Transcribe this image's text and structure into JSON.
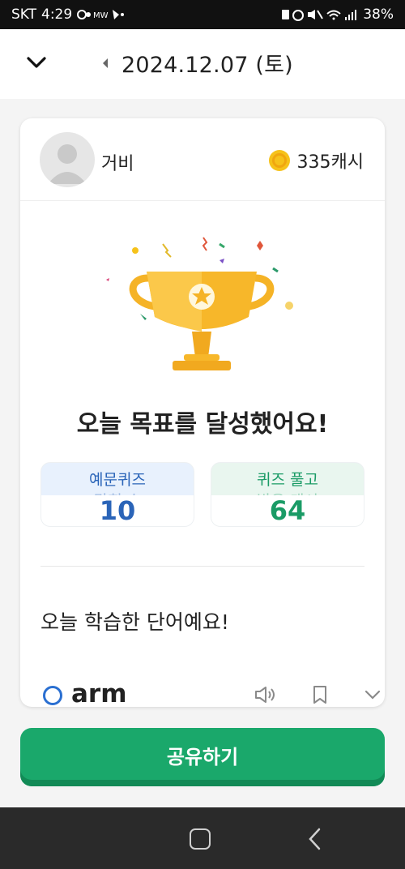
{
  "status_bar": {
    "carrier": "SKT",
    "time": "4:29",
    "battery": "38%"
  },
  "header": {
    "date": "2024.12.07 (토)",
    "back_icon": "chevron-down-icon",
    "prev_icon": "caret-left-icon"
  },
  "profile": {
    "username": "거비",
    "cash": "335캐시"
  },
  "achievement": {
    "headline": "오늘 목표를 달성했어요!"
  },
  "stats": [
    {
      "label": "예문퀴즈",
      "label_line2": "맞힌 수",
      "value": "10",
      "color": "#2a64b8",
      "bg": "#e8f1fd"
    },
    {
      "label": "퀴즈 풀고",
      "label_line2": "받은 캐시",
      "value": "64",
      "color": "#1a9b66",
      "bg": "#e9f6ef"
    }
  ],
  "words_section": {
    "title": "오늘 학습한 단어예요!",
    "items": [
      {
        "word": "arm"
      }
    ]
  },
  "share_button": {
    "label": "공유하기"
  },
  "colors": {
    "accent_green": "#1aa86b",
    "blue": "#2a64b8",
    "gold": "#f5b326"
  }
}
